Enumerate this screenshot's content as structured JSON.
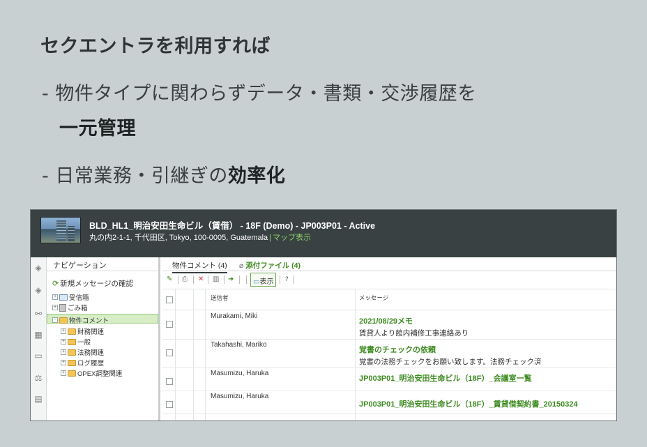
{
  "slide": {
    "headline": "セクエントラを利用すれば",
    "bullet1_line1": "- 物件タイプに関わらずデータ・書類・交渉履歴を",
    "bullet1_line2": "一元管理",
    "bullet2_prefix": "- 日常業務・引継ぎの",
    "bullet2_emphasis": "効率化"
  },
  "window": {
    "title": "BLD_HL1_明治安田生命ビル（賃借） - 18F (Demo) - JP003P01 - Active",
    "address": "丸の内2-1-1, 千代田区, Tokyo, 100-0005, Guatemala",
    "address_separator": "|",
    "map_link": "マップ表示"
  },
  "nav": {
    "title": "ナビゲーション",
    "new_messages": "新規メッセージの確認",
    "inbox": "受信箱",
    "trash": "ごみ箱",
    "property_comments": "物件コメント",
    "folders": [
      "財務関連",
      "一般",
      "法務関連",
      "ログ履歴",
      "OPEX調整関連"
    ]
  },
  "tabs": {
    "comments": "物件コメント (4)",
    "attachments": "添付ファイル (4)"
  },
  "toolbar": {
    "show_label": "表示",
    "help": "?"
  },
  "grid": {
    "col_sender": "送信者",
    "col_message": "メッセージ",
    "rows": [
      {
        "sender": "Murakami, Miki",
        "subject": "2021/08/29メモ",
        "preview": "賃貸人より館内補修工事連絡あり"
      },
      {
        "sender": "Takahashi, Mariko",
        "subject": "覚書のチェックの依頼",
        "preview": "覚書の法務チェックをお願い致します。法務チェック済"
      },
      {
        "sender": "Masumizu, Haruka",
        "subject": "JP003P01_明治安田生命ビル（18F）_会議室一覧",
        "preview": ""
      },
      {
        "sender": "Masumizu, Haruka",
        "subject": "JP003P01_明治安田生命ビル（18F）_賃貸借契約書_20150324",
        "preview": ""
      }
    ]
  },
  "colors": {
    "background": "#c9d0d1",
    "header_bar": "#394142",
    "accent_green": "#3c8a1f"
  }
}
